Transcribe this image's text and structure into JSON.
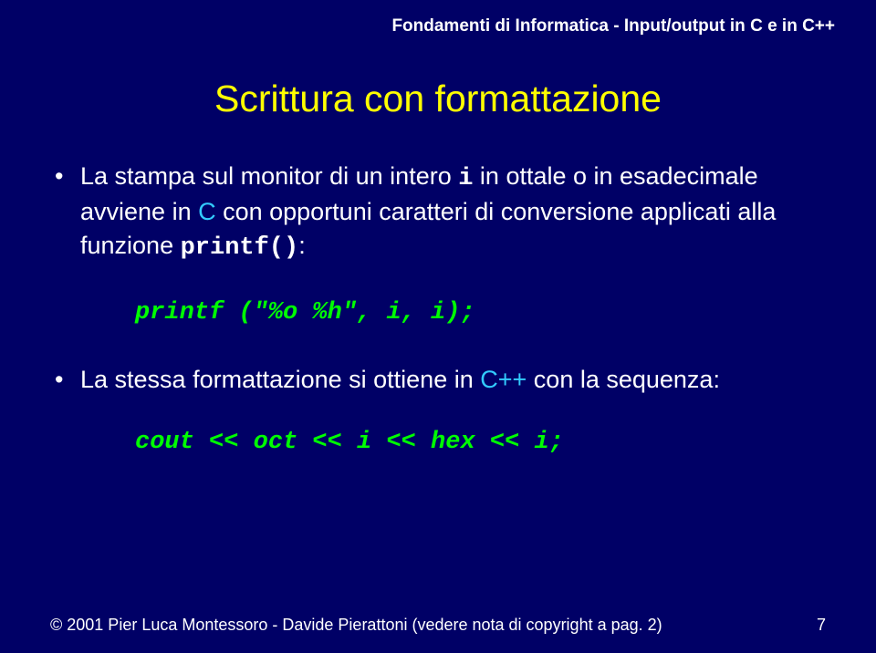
{
  "header": "Fondamenti di Informatica - Input/output in C e in C++",
  "title": "Scrittura con formattazione",
  "bullet1": {
    "pre1": "La stampa sul monitor di un intero ",
    "mono1": "i",
    "mid1": " in ottale o in esadecimale avviene in ",
    "c": "C",
    "mid2": " con opportuni caratteri di conversione applicati alla funzione ",
    "mono2": "printf()",
    "post": ":"
  },
  "code1": "printf (\"%o %h\", i, i);",
  "bullet2": {
    "pre": "La stessa formattazione si ottiene in ",
    "cpp": "C++",
    "post": " con la sequenza:"
  },
  "code2": "cout << oct << i << hex << i;",
  "footer": {
    "copyright": "© 2001   Pier Luca Montessoro - Davide Pierattoni (vedere nota di copyright a pag. 2)",
    "page": "7"
  }
}
